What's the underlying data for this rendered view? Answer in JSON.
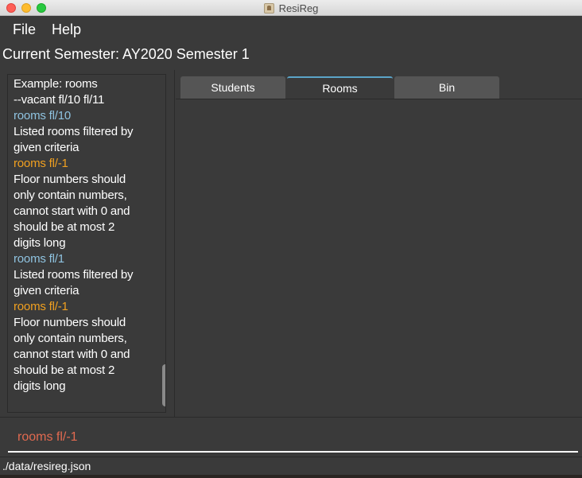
{
  "window": {
    "title": "ResiReg"
  },
  "menu": {
    "file": "File",
    "help": "Help"
  },
  "semester": {
    "label": "Current Semester: AY2020 Semester 1"
  },
  "feedback": {
    "lines": [
      {
        "kind": "text",
        "text": "Example: rooms"
      },
      {
        "kind": "text",
        "text": "--vacant fl/10 fl/11"
      },
      {
        "kind": "command",
        "text": "rooms fl/10"
      },
      {
        "kind": "text",
        "text": "Listed rooms filtered by"
      },
      {
        "kind": "text",
        "text": "given criteria"
      },
      {
        "kind": "error",
        "text": "rooms fl/-1"
      },
      {
        "kind": "text",
        "text": "Floor numbers should"
      },
      {
        "kind": "text",
        "text": "only contain numbers,"
      },
      {
        "kind": "text",
        "text": "cannot start with 0 and"
      },
      {
        "kind": "text",
        "text": "should be at most 2"
      },
      {
        "kind": "text",
        "text": "digits long"
      },
      {
        "kind": "command",
        "text": "rooms fl/1"
      },
      {
        "kind": "text",
        "text": "Listed rooms filtered by"
      },
      {
        "kind": "text",
        "text": "given criteria"
      },
      {
        "kind": "error",
        "text": "rooms fl/-1"
      },
      {
        "kind": "text",
        "text": "Floor numbers should"
      },
      {
        "kind": "text",
        "text": "only contain numbers,"
      },
      {
        "kind": "text",
        "text": "cannot start with 0 and"
      },
      {
        "kind": "text",
        "text": "should be at most 2"
      },
      {
        "kind": "text",
        "text": "digits long"
      }
    ]
  },
  "tabs": {
    "students": "Students",
    "rooms": "Rooms",
    "bin": "Bin",
    "selected": "Rooms"
  },
  "command": {
    "value": "rooms fl/-1"
  },
  "status": {
    "path": "./data/resireg.json"
  },
  "colors": {
    "command_text": "#8fc3e0",
    "error_text": "#f0a020",
    "input_text": "#e26a50",
    "tab_accent": "#5ba4c8"
  }
}
